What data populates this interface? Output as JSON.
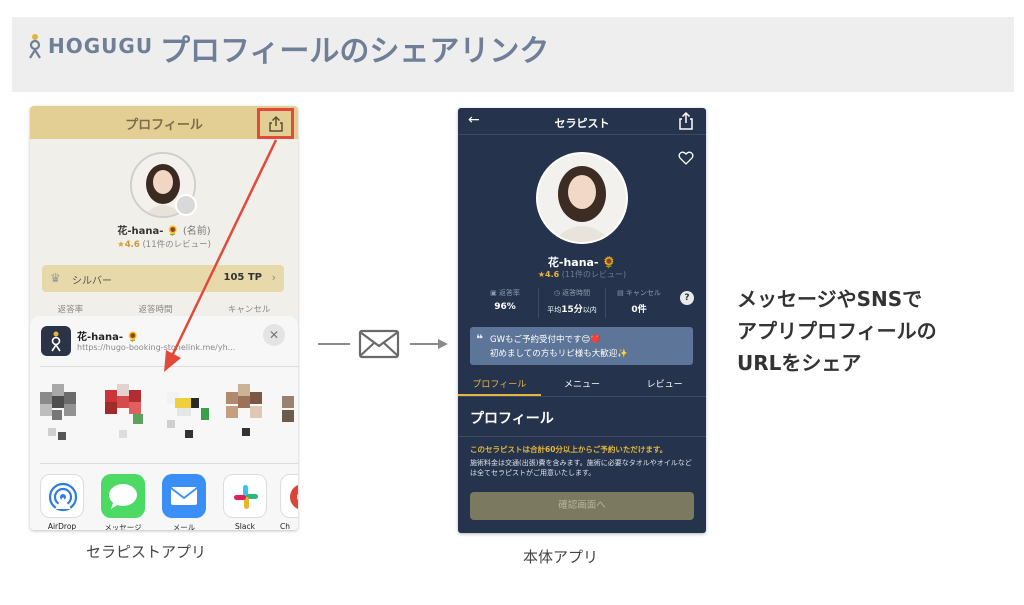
{
  "brand": {
    "logo_text": "HOGUGU"
  },
  "page_title": "プロフィールのシェアリンク",
  "left_phone": {
    "header_title": "プロフィール",
    "therapist_name": "花-hana-",
    "name_note": "(名前)",
    "rating": "4.6",
    "review_count": "(11件のレビュー)",
    "rank_label": "シルバー",
    "rank_points": "105 TP",
    "stats": [
      "返答率",
      "返答時間",
      "キャンセル"
    ],
    "share_sheet": {
      "title": "花-hana-",
      "url": "https://hugo-booking-stonelink.me/yh...",
      "apps": [
        {
          "label": "AirDrop",
          "icon": "airdrop-icon"
        },
        {
          "label": "メッセージ",
          "icon": "messages-icon"
        },
        {
          "label": "メール",
          "icon": "mail-icon"
        },
        {
          "label": "Slack",
          "icon": "slack-icon"
        },
        {
          "label": "Ch",
          "icon": "chrome-icon"
        }
      ]
    }
  },
  "left_caption": "セラピストアプリ",
  "right_phone": {
    "header_title": "セラピスト",
    "therapist_name": "花-hana-",
    "rating": "4.6",
    "review_count": "(11件のレビュー)",
    "stats": [
      {
        "label": "返答率",
        "value": "96%",
        "unit": ""
      },
      {
        "label": "返答時間",
        "value": "15分",
        "prefix": "平均",
        "unit": "以内"
      },
      {
        "label": "キャンセル",
        "value": "0件",
        "unit": ""
      }
    ],
    "note_line1": "GWもご予約受付中です😊❤️",
    "note_line2": "初めましての方もリピ様も大歓迎✨",
    "tabs": [
      "プロフィール",
      "メニュー",
      "レビュー"
    ],
    "section_title": "プロフィール",
    "body_highlight": "このセラピストは合計60分以上からご予約いただけます。",
    "body_text": "施術料金は交通(出張)費を含みます。施術に必要なタオルやオイルなどは全てセラピストがご用意いたします。",
    "confirm_button": "確認画面へ"
  },
  "right_caption": "本体アプリ",
  "description": [
    "メッセージやSNSで",
    "アプリプロフィールの",
    "URLをシェア"
  ],
  "colors": {
    "accent_red": "#e24a3b",
    "gold": "#e5b73a",
    "navy": "#25344c",
    "title_gray": "#6f7f97"
  }
}
